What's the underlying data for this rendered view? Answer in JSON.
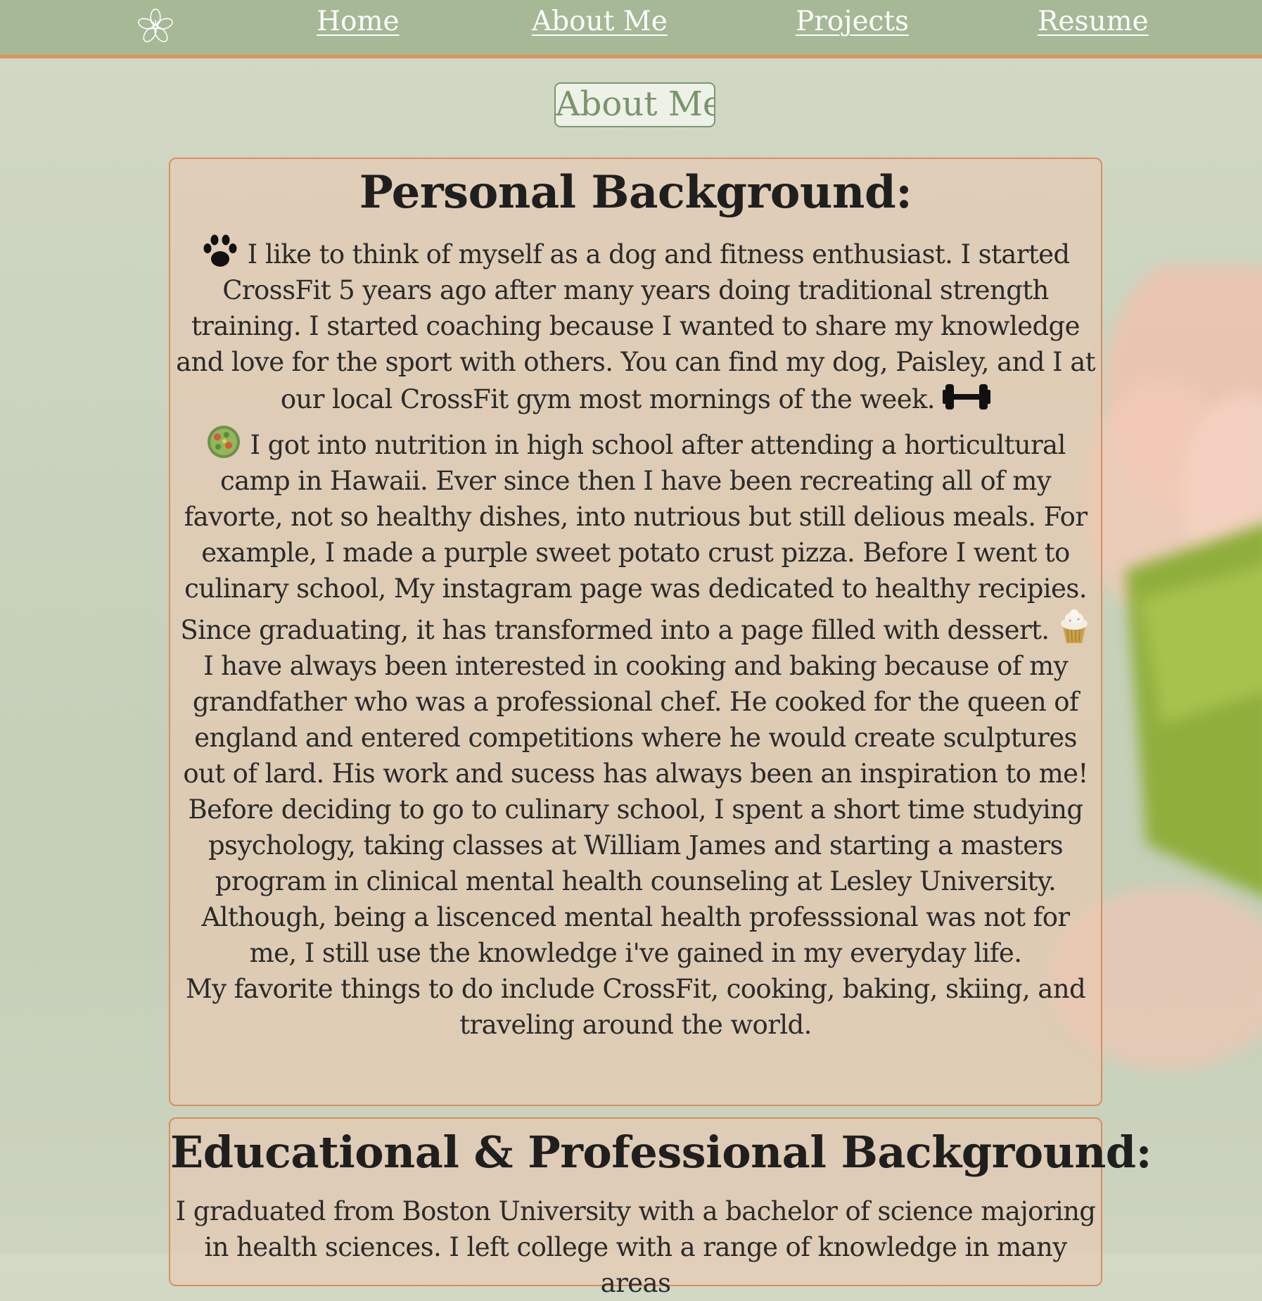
{
  "nav": {
    "items": [
      {
        "label": "Home"
      },
      {
        "label": "About Me"
      },
      {
        "label": "Projects"
      },
      {
        "label": "Resume"
      }
    ]
  },
  "page": {
    "title": "About Me"
  },
  "personal": {
    "heading": "Personal Background:",
    "paragraphs": {
      "fitness": "I like to think of myself as a dog and fitness enthusiast. I started CrossFit 5 years ago after many years doing traditional strength training. I started coaching because I wanted to share my knowledge and love for the sport with others. You can find my dog, Paisley, and I at our local CrossFit gym most mornings of the week.",
      "nutrition": "I got into nutrition in high school after attending a horticultural camp in Hawaii. Ever since then I have been recreating all of my favorte, not so healthy dishes, into nutrious but still delious meals. For example, I made a purple sweet potato crust pizza. Before I went to culinary school, My instagram page was dedicated to healthy recipies. Since graduating, it has transformed into a page filled with dessert.",
      "cooking": "I have always been interested in cooking and baking because of my grandfather who was a professional chef. He cooked for the queen of england and entered competitions where he would create sculptures out of lard. His work and sucess has always been an inspiration to me!",
      "psychology": "Before deciding to go to culinary school, I spent a short time studying psychology, taking classes at William James and starting a masters program in clinical mental health counseling at Lesley University. Although, being a liscenced mental health professsional was not for me, I still use the knowledge i've gained in my everyday life.",
      "favorites": "My favorite things to do include CrossFit, cooking, baking, skiing, and traveling around the world."
    },
    "icons": [
      "paw-icon",
      "dumbbell-icon",
      "salad-icon",
      "cupcake-icon"
    ]
  },
  "education": {
    "heading": "Educational & Professional Background:",
    "paragraph": "I graduated from Boston University with a bachelor of science majoring in health sciences. I left college with a range of knowledge in many areas"
  },
  "colors": {
    "nav_background": "#a6b896",
    "nav_border": "#e0925e",
    "card_border": "#d98d62",
    "title_text": "#7a946c"
  }
}
